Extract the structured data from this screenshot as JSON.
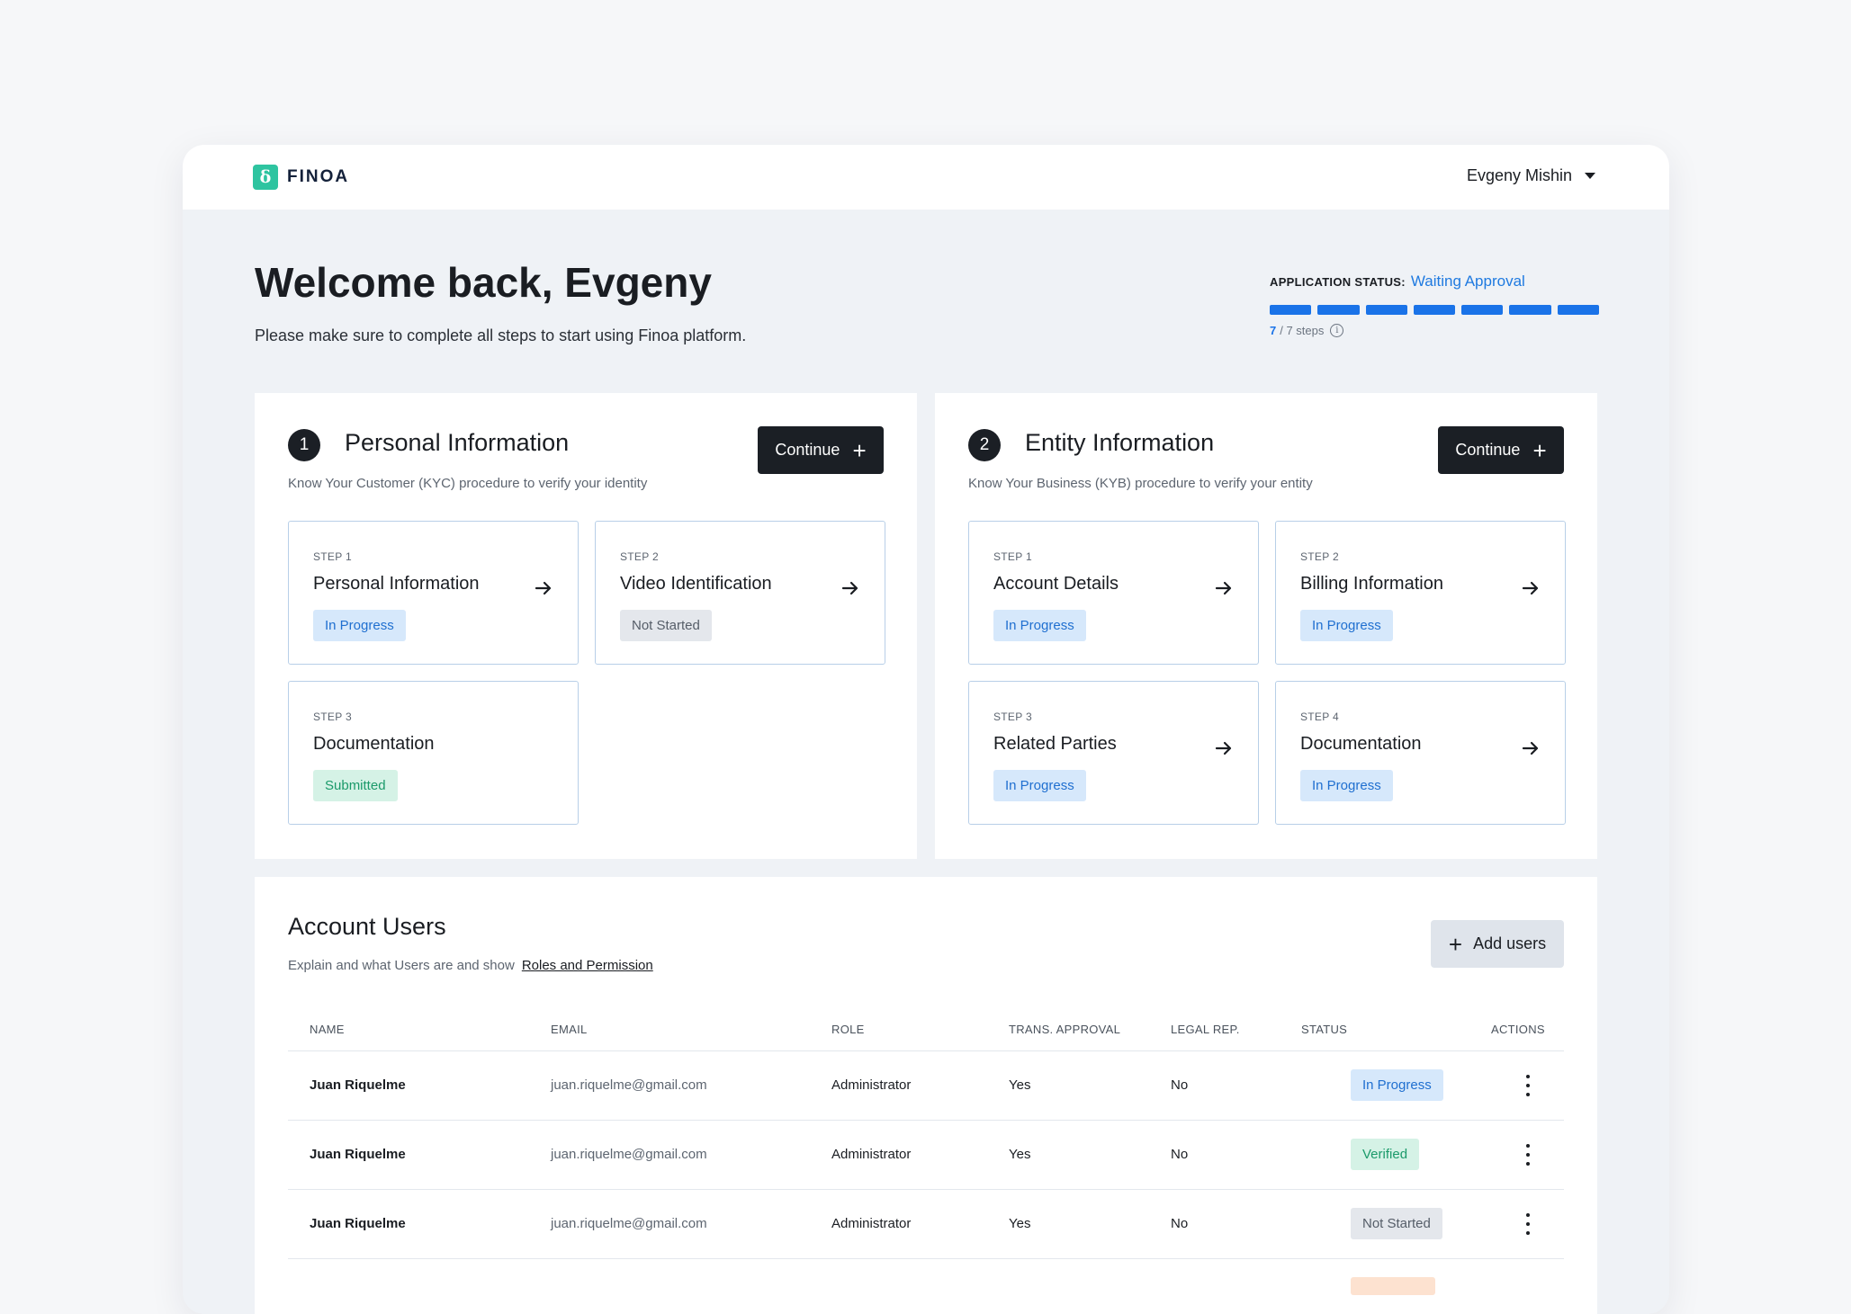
{
  "header": {
    "logo_text": "FINOA",
    "logo_mark": "ẟ",
    "user_name": "Evgeny Mishin"
  },
  "welcome": {
    "title": "Welcome back, Evgeny",
    "subtitle": "Please make sure to complete all steps to start using Finoa platform."
  },
  "application_status": {
    "label": "APPLICATION STATUS:",
    "value": "Waiting Approval",
    "steps_current": "7",
    "steps_total": "/ 7 steps",
    "segments_filled": 7,
    "segments_total": 7,
    "info_icon": "i"
  },
  "panels": [
    {
      "number": "1",
      "title": "Personal Information",
      "subtitle": "Know Your Customer (KYC) procedure to verify your identity",
      "button_label": "Continue",
      "steps": [
        {
          "label": "STEP 1",
          "title": "Personal Information",
          "status": "In Progress",
          "arrow": true
        },
        {
          "label": "STEP 2",
          "title": "Video Identification",
          "status": "Not Started",
          "arrow": true
        },
        {
          "label": "STEP 3",
          "title": "Documentation",
          "status": "Submitted",
          "arrow": false
        }
      ]
    },
    {
      "number": "2",
      "title": "Entity Information",
      "subtitle": "Know Your Business (KYB) procedure to verify your entity",
      "button_label": "Continue",
      "steps": [
        {
          "label": "STEP 1",
          "title": "Account Details",
          "status": "In Progress",
          "arrow": true
        },
        {
          "label": "STEP 2",
          "title": "Billing Information",
          "status": "In Progress",
          "arrow": true
        },
        {
          "label": "STEP 3",
          "title": "Related Parties",
          "status": "In Progress",
          "arrow": true
        },
        {
          "label": "STEP 4",
          "title": "Documentation",
          "status": "In Progress",
          "arrow": true
        }
      ]
    }
  ],
  "users": {
    "title": "Account Users",
    "subtitle": "Explain and what Users are and show",
    "link": "Roles and Permission",
    "add_button": "Add users",
    "columns": [
      "NAME",
      "EMAIL",
      "ROLE",
      "TRANS. APPROVAL",
      "LEGAL REP.",
      "STATUS",
      "ACTIONS"
    ],
    "rows": [
      {
        "name": "Juan Riquelme",
        "email": "juan.riquelme@gmail.com",
        "role": "Administrator",
        "approval": "Yes",
        "legal": "No",
        "status": "In Progress"
      },
      {
        "name": "Juan Riquelme",
        "email": "juan.riquelme@gmail.com",
        "role": "Administrator",
        "approval": "Yes",
        "legal": "No",
        "status": "Verified"
      },
      {
        "name": "Juan Riquelme",
        "email": "juan.riquelme@gmail.com",
        "role": "Administrator",
        "approval": "Yes",
        "legal": "No",
        "status": "Not Started"
      }
    ]
  },
  "colors": {
    "accent_blue": "#1a73e8",
    "brand_green": "#2ec4a0",
    "dark_button": "#1b1f25",
    "in_progress_bg": "#d6e8fb",
    "verified_bg": "#d5f2e6",
    "not_started_bg": "#e4e7ec"
  },
  "icons": {
    "arrow": "arrow-right-icon",
    "plus": "plus-icon",
    "kebab": "more-vertical-icon",
    "caret": "chevron-down-icon",
    "info": "info-icon"
  }
}
